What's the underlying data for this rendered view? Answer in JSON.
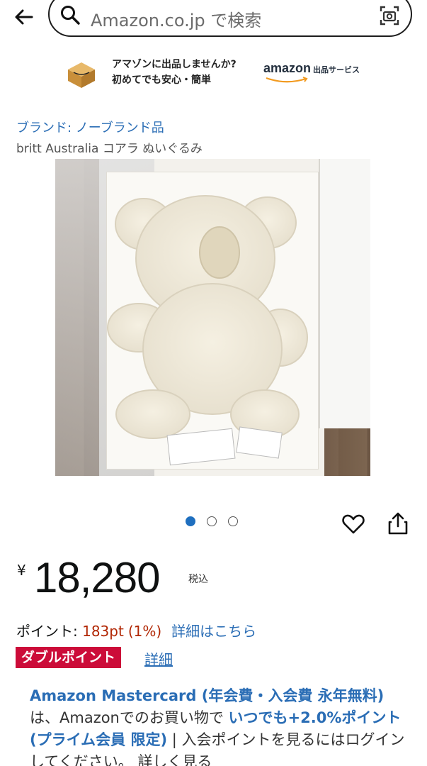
{
  "search": {
    "placeholder": "Amazon.co.jp で検索"
  },
  "banner": {
    "line1": "アマゾンに出品しませんか?",
    "line2": "初めてでも安心・簡単",
    "logo_word": "amazon",
    "logo_service": "出品サービス"
  },
  "product": {
    "brand": "ブランド: ノーブランド品",
    "title": "britt Australia コアラ ぬいぐるみ",
    "image_alt": "koala plush in box"
  },
  "carousel": {
    "count": 3,
    "active_index": 0
  },
  "price": {
    "currency": "¥",
    "amount": "18,280",
    "tax_note": "税込"
  },
  "points": {
    "label": "ポイント: ",
    "value": "183pt",
    "percent": "(1%)",
    "details_link": "詳細はこちら"
  },
  "badge": {
    "label": "ダブルポイント",
    "link": "詳細"
  },
  "promo": {
    "part1": "Amazon Mastercard (年会費・入会費 永年無料)",
    "part2": "は、Amazonでのお買い物で ",
    "part3": "いつでも+2.0%ポイント (プライム会員 限定)",
    "part4": " | ",
    "part5": "入会ポイントを見るにはログインしてください。 詳しく見る"
  },
  "colors": {
    "link": "#2a6db5",
    "price_red": "#b12704",
    "badge_red": "#cc0c39",
    "dot_active": "#1f6fbf"
  }
}
